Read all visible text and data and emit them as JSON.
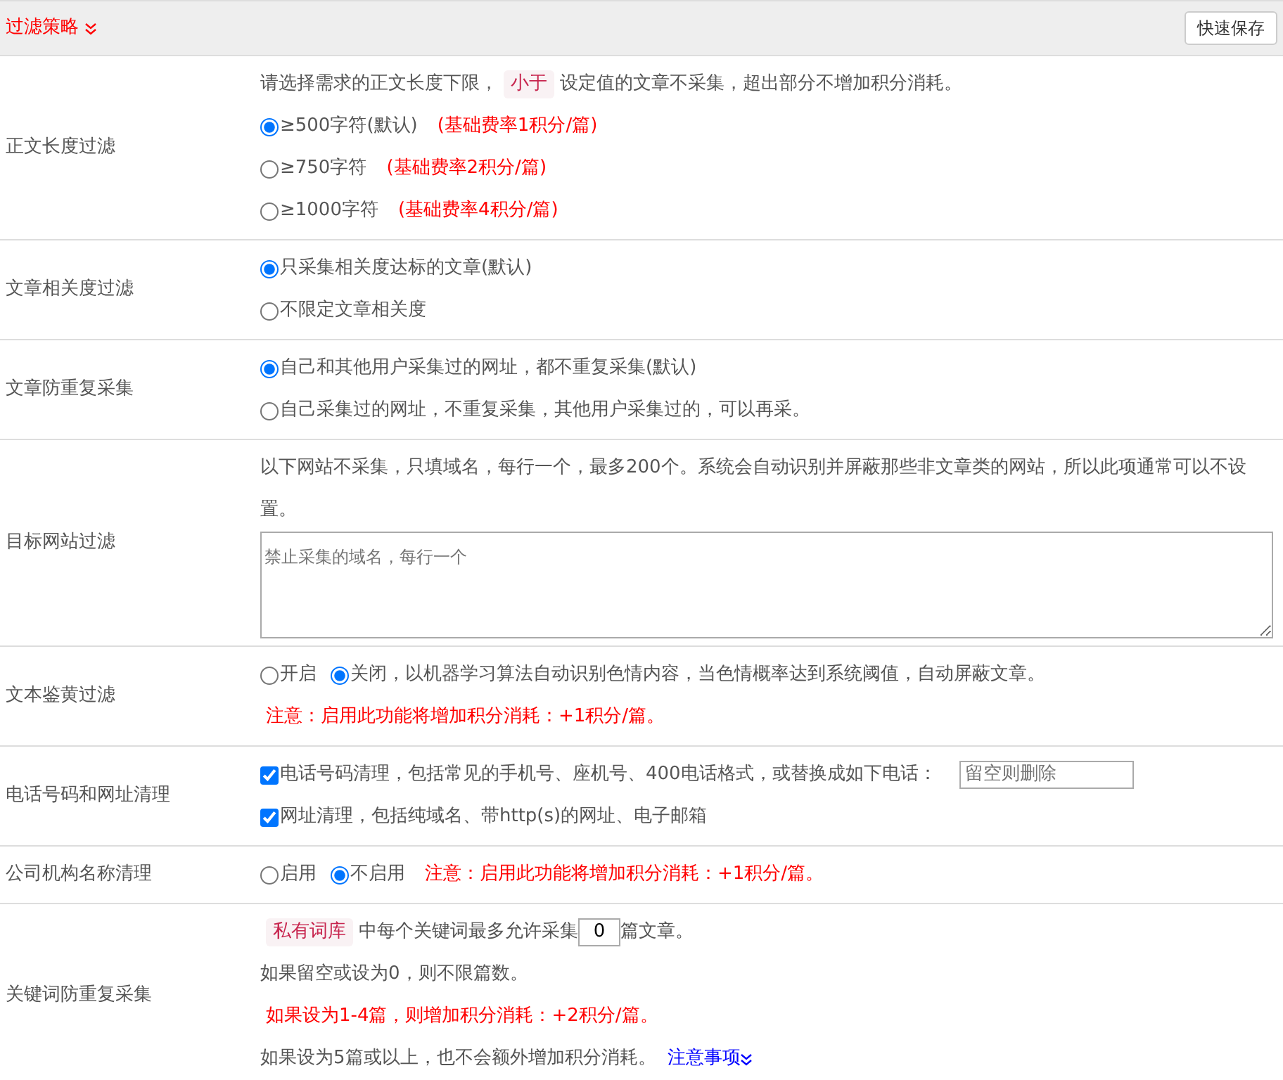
{
  "header": {
    "title": "过滤策略",
    "save_button": "快速保存"
  },
  "sections": [
    {
      "label": "正文长度过滤",
      "lines": [
        [
          {
            "kind": "text",
            "text": "请选择需求的正文长度下限，"
          },
          {
            "kind": "tag",
            "text": "小于"
          },
          {
            "kind": "text",
            "text": "设定值的文章不采集，超出部分不增加积分消耗。"
          }
        ],
        [
          {
            "kind": "radio",
            "text": "≥500字符(默认)",
            "selected": true
          },
          {
            "kind": "red",
            "text": "(基础费率1积分/篇)"
          }
        ],
        [
          {
            "kind": "radio",
            "text": "≥750字符",
            "selected": false
          },
          {
            "kind": "red",
            "text": "(基础费率2积分/篇)"
          }
        ],
        [
          {
            "kind": "radio",
            "text": "≥1000字符",
            "selected": false
          },
          {
            "kind": "red",
            "text": "(基础费率4积分/篇)"
          }
        ]
      ]
    },
    {
      "label": "文章相关度过滤",
      "lines": [
        [
          {
            "kind": "radio",
            "text": "只采集相关度达标的文章(默认)",
            "selected": true
          }
        ],
        [
          {
            "kind": "radio",
            "text": "不限定文章相关度",
            "selected": false
          }
        ]
      ]
    },
    {
      "label": "文章防重复采集",
      "lines": [
        [
          {
            "kind": "radio",
            "text": "自己和其他用户采集过的网址，都不重复采集(默认)",
            "selected": true
          }
        ],
        [
          {
            "kind": "radio",
            "text": "自己采集过的网址，不重复采集，其他用户采集过的，可以再采。",
            "selected": false
          }
        ]
      ]
    },
    {
      "label": "目标网站过滤",
      "lines": [
        [
          {
            "kind": "text",
            "text": "以下网站不采集，只填域名，每行一个，最多200个。系统会自动识别并屏蔽那些非文章类的网站，所以此项通常可以不设置。"
          }
        ],
        [
          {
            "kind": "textarea",
            "placeholder": "禁止采集的域名，每行一个"
          }
        ]
      ]
    },
    {
      "label": "文本鉴黄过滤",
      "lines": [
        [
          {
            "kind": "radio",
            "text": "开启",
            "selected": false
          },
          {
            "kind": "radio",
            "text": "关闭，以机器学习算法自动识别色情内容，当色情概率达到系统阈值，自动屏蔽文章。",
            "selected": true
          }
        ],
        [
          {
            "kind": "red",
            "text": "注意：启用此功能将增加积分消耗：+1积分/篇。"
          }
        ]
      ]
    },
    {
      "label": "电话号码和网址清理",
      "lines": [
        [
          {
            "kind": "checkbox",
            "text": "电话号码清理，包括常见的手机号、座机号、400电话格式，或替换成如下电话：",
            "checked": true
          },
          {
            "kind": "input",
            "placeholder": "留空则删除"
          }
        ],
        [
          {
            "kind": "checkbox",
            "text": "网址清理，包括纯域名、带http(s)的网址、电子邮箱",
            "checked": true
          }
        ]
      ]
    },
    {
      "label": "公司机构名称清理",
      "lines": [
        [
          {
            "kind": "radio",
            "text": "启用",
            "selected": false
          },
          {
            "kind": "radio",
            "text": "不启用",
            "selected": true
          },
          {
            "kind": "red",
            "text": "注意：启用此功能将增加积分消耗：+1积分/篇。"
          }
        ]
      ]
    },
    {
      "label": "关键词防重复采集",
      "lines": [
        [
          {
            "kind": "tag",
            "text": "私有词库"
          },
          {
            "kind": "text",
            "text": "中每个关键词最多允许采集"
          },
          {
            "kind": "number",
            "value": "0"
          },
          {
            "kind": "text",
            "text": "篇文章。"
          }
        ],
        [
          {
            "kind": "text",
            "text": "如果留空或设为0，则不限篇数。"
          }
        ],
        [
          {
            "kind": "red",
            "text": "如果设为1-4篇，则增加积分消耗：+2积分/篇。"
          }
        ],
        [
          {
            "kind": "text",
            "text": "如果设为5篇或以上，也不会额外增加积分消耗。"
          },
          {
            "kind": "link",
            "text": "注意事项"
          }
        ]
      ]
    }
  ]
}
